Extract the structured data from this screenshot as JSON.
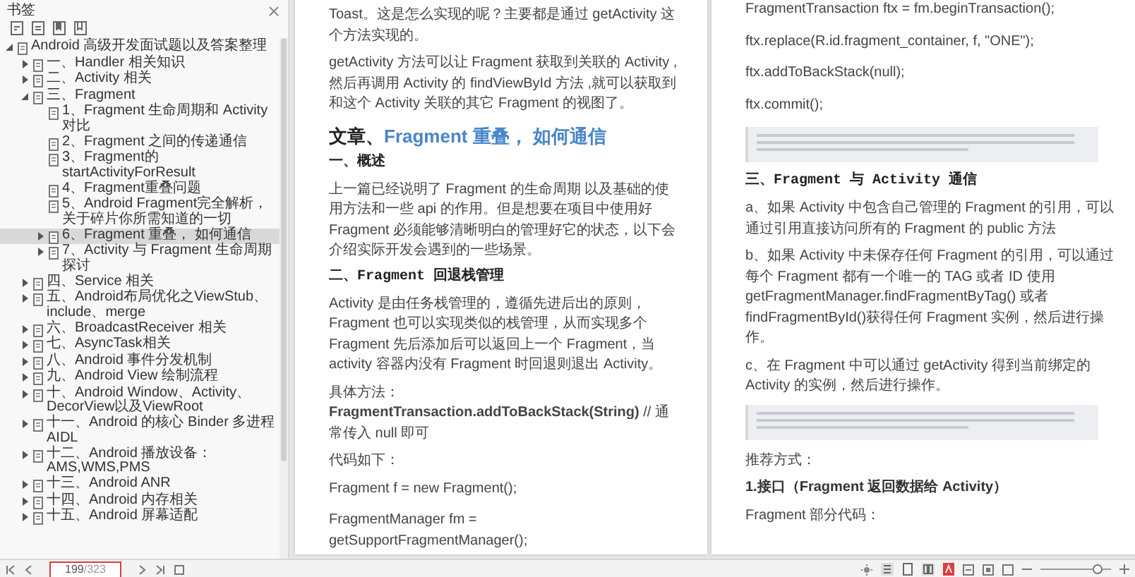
{
  "sidebar": {
    "title": "书签",
    "bookmarks": [
      {
        "label": "Android 高级开发面试题以及答案整理",
        "kind": "branch",
        "expanded": true,
        "selected": false,
        "children": [
          {
            "label": "一、Handler 相关知识",
            "kind": "branch",
            "expanded": false,
            "selected": false
          },
          {
            "label": "二、Activity 相关",
            "kind": "branch",
            "expanded": false,
            "selected": false
          },
          {
            "label": "三、Fragment",
            "kind": "branch",
            "expanded": true,
            "selected": false,
            "children": [
              {
                "label": "1、Fragment 生命周期和 Activity 对比",
                "kind": "leaf",
                "selected": false
              },
              {
                "label": "2、Fragment 之间的传递通信",
                "kind": "leaf",
                "selected": false
              },
              {
                "label": "3、Fragment的startActivityForResult",
                "kind": "leaf",
                "selected": false
              },
              {
                "label": "4、Fragment重叠问题",
                "kind": "leaf",
                "selected": false
              },
              {
                "label": "5、Android Fragment完全解析，关于碎片你所需知道的一切",
                "kind": "leaf",
                "selected": false
              },
              {
                "label": "6、Fragment 重叠， 如何通信",
                "kind": "branch",
                "expanded": false,
                "selected": true
              },
              {
                "label": "7、Activity 与 Fragment 生命周期探讨",
                "kind": "branch",
                "expanded": false,
                "selected": false
              }
            ]
          },
          {
            "label": "四、Service 相关",
            "kind": "branch",
            "expanded": false,
            "selected": false
          },
          {
            "label": "五、Android布局优化之ViewStub、include、merge",
            "kind": "branch",
            "expanded": false,
            "selected": false
          },
          {
            "label": "六、BroadcastReceiver 相关",
            "kind": "branch",
            "expanded": false,
            "selected": false
          },
          {
            "label": "七、AsyncTask相关",
            "kind": "branch",
            "expanded": false,
            "selected": false
          },
          {
            "label": "八、Android 事件分发机制",
            "kind": "branch",
            "expanded": false,
            "selected": false
          },
          {
            "label": "九、Android View 绘制流程",
            "kind": "branch",
            "expanded": false,
            "selected": false
          },
          {
            "label": "十、Android Window、Activity、DecorView以及ViewRoot",
            "kind": "branch",
            "expanded": false,
            "selected": false
          },
          {
            "label": "十一、Android 的核心 Binder 多进程 AIDL",
            "kind": "branch",
            "expanded": false,
            "selected": false
          },
          {
            "label": "十二、Android 播放设备：AMS,WMS,PMS",
            "kind": "branch",
            "expanded": false,
            "selected": false
          },
          {
            "label": "十三、Android ANR",
            "kind": "branch",
            "expanded": false,
            "selected": false
          },
          {
            "label": "十四、Android 内存相关",
            "kind": "branch",
            "expanded": false,
            "selected": false
          },
          {
            "label": "十五、Android 屏幕适配",
            "kind": "branch",
            "expanded": false,
            "selected": false
          }
        ]
      }
    ]
  },
  "pages": [
    {
      "blocks": [
        {
          "kind": "para",
          "text": "Toast。这是怎么实现的呢？主要都是通过 getActivity 这个方法实现的。"
        },
        {
          "kind": "para",
          "text": "getActivity 方法可以让 Fragment 获取到关联的 Activity ,然后再调用 Activity 的 findViewById 方法 ,就可以获取到和这个 Activity 关联的其它 Fragment 的视图了。"
        },
        {
          "kind": "heading",
          "prefix": "文章、",
          "title": "Fragment 重叠， 如何通信"
        },
        {
          "kind": "subheading",
          "text": "一、概述"
        },
        {
          "kind": "para",
          "text": "上一篇已经说明了 Fragment 的生命周期 以及基础的使用方法和一些 api 的作用。但是想要在项目中使用好 Fragment 必须能够清晰明白的管理好它的状态，以下会介绍实际开发会遇到的一些场景。"
        },
        {
          "kind": "subheading",
          "text": "二、Fragment 回退栈管理"
        },
        {
          "kind": "para",
          "text": "Activity 是由任务栈管理的，遵循先进后出的原则，Fragment 也可以实现类似的栈管理，从而实现多个 Fragment 先后添加后可以返回上一个 Fragment，当 activity 容器内没有 Fragment 时回退则退出 Activity。"
        },
        {
          "kind": "para",
          "text": "具体方法：**FragmentTransaction.addToBackStack(String)** // 通常传入 null 即可"
        },
        {
          "kind": "para",
          "text": "代码如下："
        },
        {
          "kind": "code",
          "text": "Fragment f = new Fragment();"
        },
        {
          "kind": "code",
          "text": "FragmentManager fm = getSupportFragmentManager();"
        }
      ]
    },
    {
      "blocks": [
        {
          "kind": "code",
          "text": "FragmentTransaction ftx = fm.beginTransaction();"
        },
        {
          "kind": "code",
          "text": "ftx.replace(R.id.fragment_container, f, \"ONE\");"
        },
        {
          "kind": "code",
          "text": "ftx.addToBackStack(null);"
        },
        {
          "kind": "code",
          "text": "ftx.commit();"
        },
        {
          "kind": "note"
        },
        {
          "kind": "subheading",
          "text": "三、Fragment 与 Activity 通信"
        },
        {
          "kind": "para",
          "text": "a、如果 Activity 中包含自己管理的 Fragment 的引用，可以通过引用直接访问所有的 Fragment 的 public 方法"
        },
        {
          "kind": "para",
          "text": "b、如果 Activity 中未保存任何 Fragment 的引用，可以通过每个 Fragment 都有一个唯一的 TAG 或者 ID 使用 getFragmentManager.findFragmentByTag() 或者 findFragmentById()获得任何 Fragment 实例，然后进行操作。"
        },
        {
          "kind": "para",
          "text": "c、在 Fragment 中可以通过 getActivity 得到当前绑定的 Activity 的实例，然后进行操作。"
        },
        {
          "kind": "note"
        },
        {
          "kind": "para",
          "text": "推荐方式："
        },
        {
          "kind": "strong",
          "text": "1.接口（Fragment 返回数据给 Activity）"
        },
        {
          "kind": "para",
          "text": "Fragment 部分代码："
        }
      ]
    }
  ],
  "status_bar": {
    "page": "199",
    "total": "/323",
    "zoom": {
      "level": 0.85
    }
  }
}
